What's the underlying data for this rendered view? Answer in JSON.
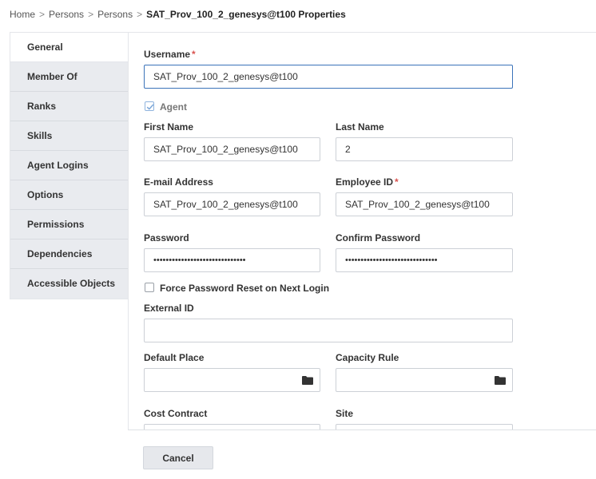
{
  "breadcrumb": {
    "items": [
      "Home",
      "Persons",
      "Persons"
    ],
    "separator": ">",
    "current": "SAT_Prov_100_2_genesys@t100 Properties"
  },
  "tabs": [
    {
      "label": "General",
      "active": true
    },
    {
      "label": "Member Of"
    },
    {
      "label": "Ranks"
    },
    {
      "label": "Skills"
    },
    {
      "label": "Agent Logins"
    },
    {
      "label": "Options"
    },
    {
      "label": "Permissions"
    },
    {
      "label": "Dependencies"
    },
    {
      "label": "Accessible Objects"
    }
  ],
  "form": {
    "required_mark": "*",
    "username": {
      "label": "Username",
      "value": "SAT_Prov_100_2_genesys@t100"
    },
    "agent": {
      "label": "Agent",
      "checked": true
    },
    "first_name": {
      "label": "First Name",
      "value": "SAT_Prov_100_2_genesys@t100"
    },
    "last_name": {
      "label": "Last Name",
      "value": "2"
    },
    "email": {
      "label": "E-mail Address",
      "value": "SAT_Prov_100_2_genesys@t100"
    },
    "employee_id": {
      "label": "Employee ID",
      "value": "SAT_Prov_100_2_genesys@t100"
    },
    "password": {
      "label": "Password",
      "value": "••••••••••••••••••••••••••••••"
    },
    "confirm_password": {
      "label": "Confirm Password",
      "value": "••••••••••••••••••••••••••••••"
    },
    "force_reset": {
      "label": "Force Password Reset on Next Login",
      "checked": false
    },
    "external_id": {
      "label": "External ID",
      "value": ""
    },
    "default_place": {
      "label": "Default Place",
      "value": ""
    },
    "capacity_rule": {
      "label": "Capacity Rule",
      "value": ""
    },
    "cost_contract": {
      "label": "Cost Contract"
    },
    "site": {
      "label": "Site"
    }
  },
  "footer": {
    "cancel_label": "Cancel"
  },
  "icons": {
    "folder": "folder-icon",
    "check": "checkmark-icon"
  },
  "colors": {
    "focus": "#3b73b9",
    "required": "#d9534f",
    "tab_bg": "#e9ebef"
  }
}
